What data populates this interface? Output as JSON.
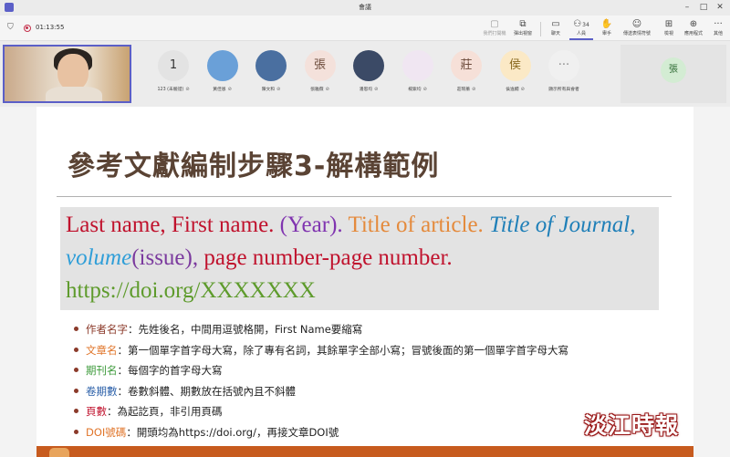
{
  "window": {
    "title": "會議"
  },
  "toolbar": {
    "timer": "01:13:55",
    "buttons": [
      {
        "id": "ai",
        "label": "我們打開機",
        "icon": "robot-icon",
        "dim": true
      },
      {
        "id": "popout",
        "label": "彈出視窗",
        "icon": "popout-icon",
        "dim": false
      },
      {
        "id": "chat",
        "label": "聊天",
        "icon": "chat-icon",
        "dim": false
      },
      {
        "id": "people",
        "label": "人員",
        "icon": "people-icon",
        "count": "34",
        "dim": false
      },
      {
        "id": "raise-hand",
        "label": "舉手",
        "icon": "hand-icon",
        "dim": false
      },
      {
        "id": "react",
        "label": "傳送表情符號",
        "icon": "smile-icon",
        "dim": false
      },
      {
        "id": "view",
        "label": "檢視",
        "icon": "grid-icon",
        "dim": false
      },
      {
        "id": "apps",
        "label": "應用程式",
        "icon": "apps-icon",
        "dim": false
      },
      {
        "id": "more",
        "label": "其他",
        "icon": "more-icon",
        "dim": false
      }
    ]
  },
  "participants": [
    {
      "initials": "1",
      "name": "123 (未驗證)",
      "bg": "#e3e3e3",
      "fg": "#333333"
    },
    {
      "initials": "",
      "name": "黃佳恩",
      "bg": "#6aa0d8",
      "fg": "#ffffff"
    },
    {
      "initials": "",
      "name": "陳文和",
      "bg": "#4a6fa0",
      "fg": "#ffffff"
    },
    {
      "initials": "張",
      "name": "張雅薇",
      "bg": "#f4e1db",
      "fg": "#6b4a3a"
    },
    {
      "initials": "",
      "name": "潘思均",
      "bg": "#3b4a66",
      "fg": "#ffffff"
    },
    {
      "initials": "",
      "name": "楊紫均",
      "bg": "#f0e6f2",
      "fg": "#8a5a90"
    },
    {
      "initials": "莊",
      "name": "莊琬蓁",
      "bg": "#f6e0d8",
      "fg": "#6b4a3a"
    },
    {
      "initials": "侯",
      "name": "侯逸嫺",
      "bg": "#fbe9c6",
      "fg": "#8a6a20"
    },
    {
      "initials": "···",
      "name": "顯示所有與會者",
      "bg": "#f0f0f0",
      "fg": "#888888"
    }
  ],
  "right_tile": {
    "initials": "張"
  },
  "slide": {
    "title": "參考文獻編制步驟3-解構範例",
    "formula": {
      "author": "Last name, First name. ",
      "year": "(Year). ",
      "article_title": "Title of article. ",
      "journal": "Title of Journal, ",
      "volume": "volume",
      "issue": "(issue), ",
      "pages": "page number-page number.",
      "doi": "https://doi.org/XXXXXXX"
    },
    "bullets": [
      {
        "term": "作者名字",
        "text": "：先姓後名，中間用逗號格開，First Name要縮寫",
        "color": "#8b3a2a"
      },
      {
        "term": "文章名",
        "text": "：第一個單字首字母大寫，除了專有名詞，其餘單字全部小寫；冒號後面的第一個單字首字母大寫",
        "color": "#e0752a"
      },
      {
        "term": "期刊名",
        "text": "：每個字的首字母大寫",
        "color": "#3c9a3a"
      },
      {
        "term": "卷期數",
        "text": "：卷數斜體、期數放在括號內且不斜體",
        "color": "#2a5fa8"
      },
      {
        "term": "頁數",
        "text": "：為起訖頁，非引用頁碼",
        "color": "#c0122d"
      },
      {
        "term": "DOI號碼",
        "text": "：開頭均為https://doi.org/，再接文章DOI號",
        "color": "#e0752a"
      }
    ]
  },
  "watermark": "淡江時報"
}
